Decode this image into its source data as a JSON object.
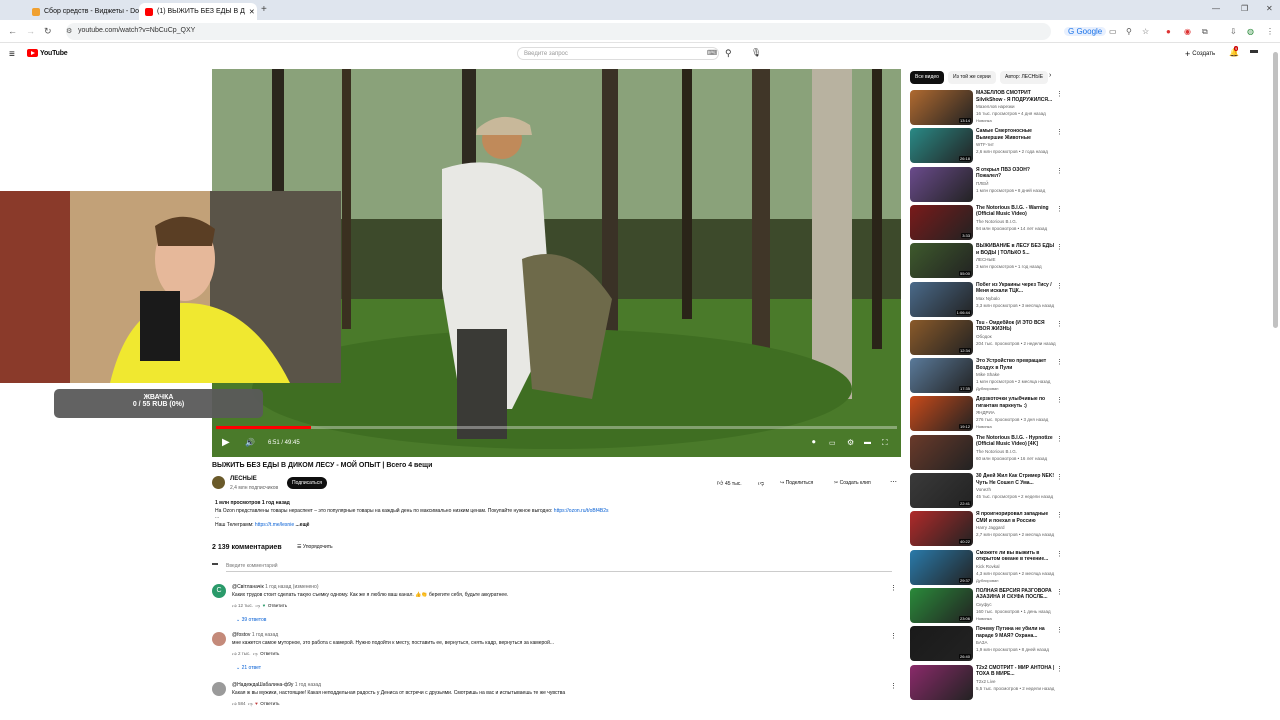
{
  "browser": {
    "tabs": [
      {
        "title": "Сбор средств - Виджеты - Do"
      },
      {
        "title": "(1) ВЫЖИТЬ БЕЗ ЕДЫ В Д"
      }
    ],
    "url": "youtube.com/watch?v=NbCuCp_QXY",
    "google_label": "Google"
  },
  "youtube": {
    "logo": "YouTube",
    "search_placeholder": "Введите запрос",
    "create_label": "Создать",
    "notif_count": "9"
  },
  "overlay": {
    "donation_title": "ЖВАЧКА",
    "donation_progress": "0 / 55 RUB (0%)",
    "donation_fraction": 0
  },
  "player": {
    "time": "6:51 / 49:45",
    "progress_fraction": 0.14
  },
  "video": {
    "title": "ВЫЖИТЬ БЕЗ ЕДЫ В ДИКОМ ЛЕСУ - МОЙ ОПЫТ | Всего 4 вещи",
    "channel": "ЛЕСНЫЕ",
    "subscribers": "2,4 млн подписчиков",
    "subscribe": "Подписаться",
    "likes": "45 тыс.",
    "share": "Поделиться",
    "clip": "Создать клип",
    "views_date": "1 млн просмотров  1 год назад",
    "description": "На Ozon представлены товары нераспеет – это популярные товары на каждый день по максимально низким ценам. Покупайте нужное выгодно:",
    "description_link": "https://ozon.ru/t/oBf4B2s",
    "ellipsis": "...",
    "telegram": "Наш Телеграмм:",
    "telegram_link": "https://t.me/lesnie",
    "more": "...ещё"
  },
  "comments": {
    "count": "2 139 комментариев",
    "sort": "Упорядочить",
    "add_placeholder": "Введите комментарий",
    "reply_label": "Ответить",
    "items": [
      {
        "author": "@Світланачік",
        "time": "1 год назад (изменено)",
        "text": "Каких трудов стоит сделать такую съемку одному. Как же я люблю ваш канал. 👍👏 берегите себя, будьте аккуратнее.",
        "likes": "12 тыс.",
        "replies": "39 ответов",
        "avatar_letter": "С"
      },
      {
        "author": "@fostov",
        "time": "1 год назад",
        "text": "мне кажется самое муторное, это работа с камерой. Нужно подойти к месту, поставить ее, вернуться, снять кадр, вернуться за камерой...",
        "likes": "2 тыс.",
        "replies": "21 ответ",
        "avatar_letter": ""
      },
      {
        "author": "@НадеждаШабалина-ф9у",
        "time": "1 год назад",
        "text": "Какая ж вы мужики, настоящие! Какая неподдельная радость у Дениса от встречи с друзьями. Смотришь на вас и испытываешь те же чувства",
        "likes": "584",
        "replies": "",
        "avatar_letter": ""
      }
    ]
  },
  "sidebar": {
    "chips": [
      "Все видео",
      "Из той же серии",
      "Автор: ЛЕСНЫЕ"
    ],
    "items": [
      {
        "title": "МАЗЕЛЛОВ СМОТРИТ SilvikShow - Я ПОДРУЖИЛСЯ...",
        "channel": "Мазеллов нарезки",
        "views": "16 тыс. просмотров • 4 дня назад",
        "badge": "Новинка",
        "duration": "13:14",
        "thumb": "#b06a30"
      },
      {
        "title": "Самые Смертоносные Вымершие Животные",
        "channel": "WTF-тит",
        "views": "2,6 млн просмотров • 2 года назад",
        "badge": "",
        "duration": "26:18",
        "thumb": "#2a8a86"
      },
      {
        "title": "Я открыл ПВЗ ОЗОН? Пожалел?",
        "channel": "ПЛЕЙ",
        "views": "1 млн просмотров • 8 дней назад",
        "badge": "",
        "duration": "",
        "thumb": "#6a4b8c"
      },
      {
        "title": "The Notorious B.I.G. - Warning (Official Music Video)",
        "channel": "The Notorious B.I.G.",
        "views": "94 млн просмотров • 14 лет назад",
        "badge": "",
        "duration": "3:33",
        "thumb": "#7a1a1a"
      },
      {
        "title": "ВЫЖИВАНИЕ в ЛЕСУ БЕЗ ЕДЫ и ВОДЫ | ТОЛЬКО 5...",
        "channel": "ЛЕСНЫЕ",
        "views": "3 млн просмотров • 1 год назад",
        "badge": "",
        "duration": "55:00",
        "thumb": "#3e5a2c"
      },
      {
        "title": "Побег из Украины через Тису / Меня искали ТЦК...",
        "channel": "Max Nybalo",
        "views": "3,3 млн просмотров • 3 месяца назад",
        "badge": "",
        "duration": "1:06:44",
        "thumb": "#4a6a8a"
      },
      {
        "title": "Tsu - Омдебйок (И ЭТО ВСЯ ТВОЯ ЖИЗНЬ)",
        "channel": "Ободок",
        "views": "204 тыс. просмотров • 2 недели назад",
        "badge": "",
        "duration": "12:34",
        "thumb": "#8a5a2a"
      },
      {
        "title": "Это Устройство превращает Воздух в Пули",
        "channel": "Mike Shake",
        "views": "1 млн просмотров • 2 месяца назад",
        "badge": "Дублирован",
        "duration": "17:35",
        "thumb": "#5a7a9a"
      },
      {
        "title": "Дерзкоточки улыбчивые по гигантам паркнуть :)",
        "channel": "ЯНДРИА",
        "views": "276 тыс. просмотров • 3 дня назад",
        "badge": "Новинка",
        "duration": "19:12",
        "thumb": "#c84a1a"
      },
      {
        "title": "The Notorious B.I.G. - Hypnotize (Official Music Video) [4K]",
        "channel": "The Notorious B.I.G.",
        "views": "60 млн просмотров • 16 лет назад",
        "badge": "",
        "duration": "",
        "thumb": "#6a3a2a"
      },
      {
        "title": "30 Дней Жил Как Стример NEK! Чуть Не Сошел С Ума...",
        "channel": "Vonezh",
        "views": "45 тыс. просмотров • 2 недели назад",
        "badge": "",
        "duration": "22:41",
        "thumb": "#3a3a3a"
      },
      {
        "title": "Я проигнорировал западные СМИ и поехал в Россию",
        "channel": "Harry Jaggard",
        "views": "2,7 млн просмотров • 2 месяца назад",
        "badge": "",
        "duration": "40:22",
        "thumb": "#b02a2a"
      },
      {
        "title": "Сможете ли вы выжить в открытом океане в течение...",
        "channel": "Kick Rovkal",
        "views": "4,3 млн просмотров • 2 месяца назад",
        "badge": "Дублирован",
        "duration": "29:37",
        "thumb": "#2a7aaa"
      },
      {
        "title": "ПОЛНАЯ ВЕРСИЯ РАЗГОВОРА АЗАЗИНА И СКУФА ПОСЛЕ...",
        "channel": "Скуфус",
        "views": "160 тыс. просмотров • 1 день назад",
        "badge": "Новинка",
        "duration": "23:06",
        "thumb": "#2a8a3a"
      },
      {
        "title": "Почему Путина не убили на параде 9 МАЯ? Охрана...",
        "channel": "БАЗА",
        "views": "1,9 млн просмотров • 8 дней назад",
        "badge": "",
        "duration": "26:40",
        "thumb": "#1a1a1a"
      },
      {
        "title": "T2x2 СМОТРИТ - МИР АНТОНА | ТОХА В МИРЕ...",
        "channel": "T2x2 Live",
        "views": "5,5 тыс. просмотров • 2 недели назад",
        "badge": "",
        "duration": "",
        "thumb": "#8a2a6a"
      }
    ]
  },
  "colors": {
    "youtube_red": "#ff0000",
    "subscribe_bg": "#0f0f0f",
    "link_blue": "#065fd4"
  }
}
